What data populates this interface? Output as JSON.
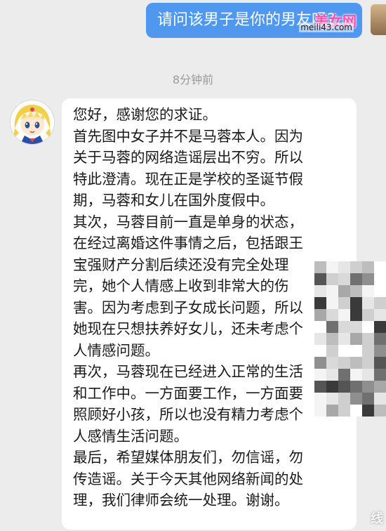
{
  "outgoing_message": {
    "text": "请问该男子是你的男友吗?"
  },
  "watermark": {
    "text": "美女网",
    "url": "meili43.com",
    "corner": "线"
  },
  "timestamp": "8分钟前",
  "incoming_message": {
    "lines": [
      "您好，感谢您的求证。",
      "首先图中女子并不是马蓉本人。因为",
      "关于马蓉的网络造谣层出不穷。所以",
      "特此澄清。现在正是学校的圣诞节假",
      "期，马蓉和女儿在国外度假中。",
      "其次，马蓉目前一直是单身的状态，",
      "在经过离婚这件事情之后，包括跟王",
      "宝强财产分割后续还没有完全处理",
      "完，她个人情感上收到非常大的伤",
      "害。因为考虑到子女成长问题，所以",
      "她现在只想扶养好女儿，还未考虑个",
      "人情感问题。",
      "再次，马蓉现在已经进入正常的生活",
      "和工作中。一方面要工作，一方面要",
      "照顾好小孩，所以也没有精力考虑个",
      "人感情生活问题。",
      "最后，希望媒体朋友们，勿信谣，勿",
      "传造谣。关于今天其他网络新闻的处",
      "理，我们律师会统一处理。谢谢。"
    ]
  },
  "colors": {
    "outgoing_bubble": "#4f97ef",
    "incoming_bubble": "#ffffff",
    "background": "#ececec",
    "timestamp": "#9a9a9a"
  },
  "icons": {
    "avatar": "anime-girl-avatar-icon"
  }
}
